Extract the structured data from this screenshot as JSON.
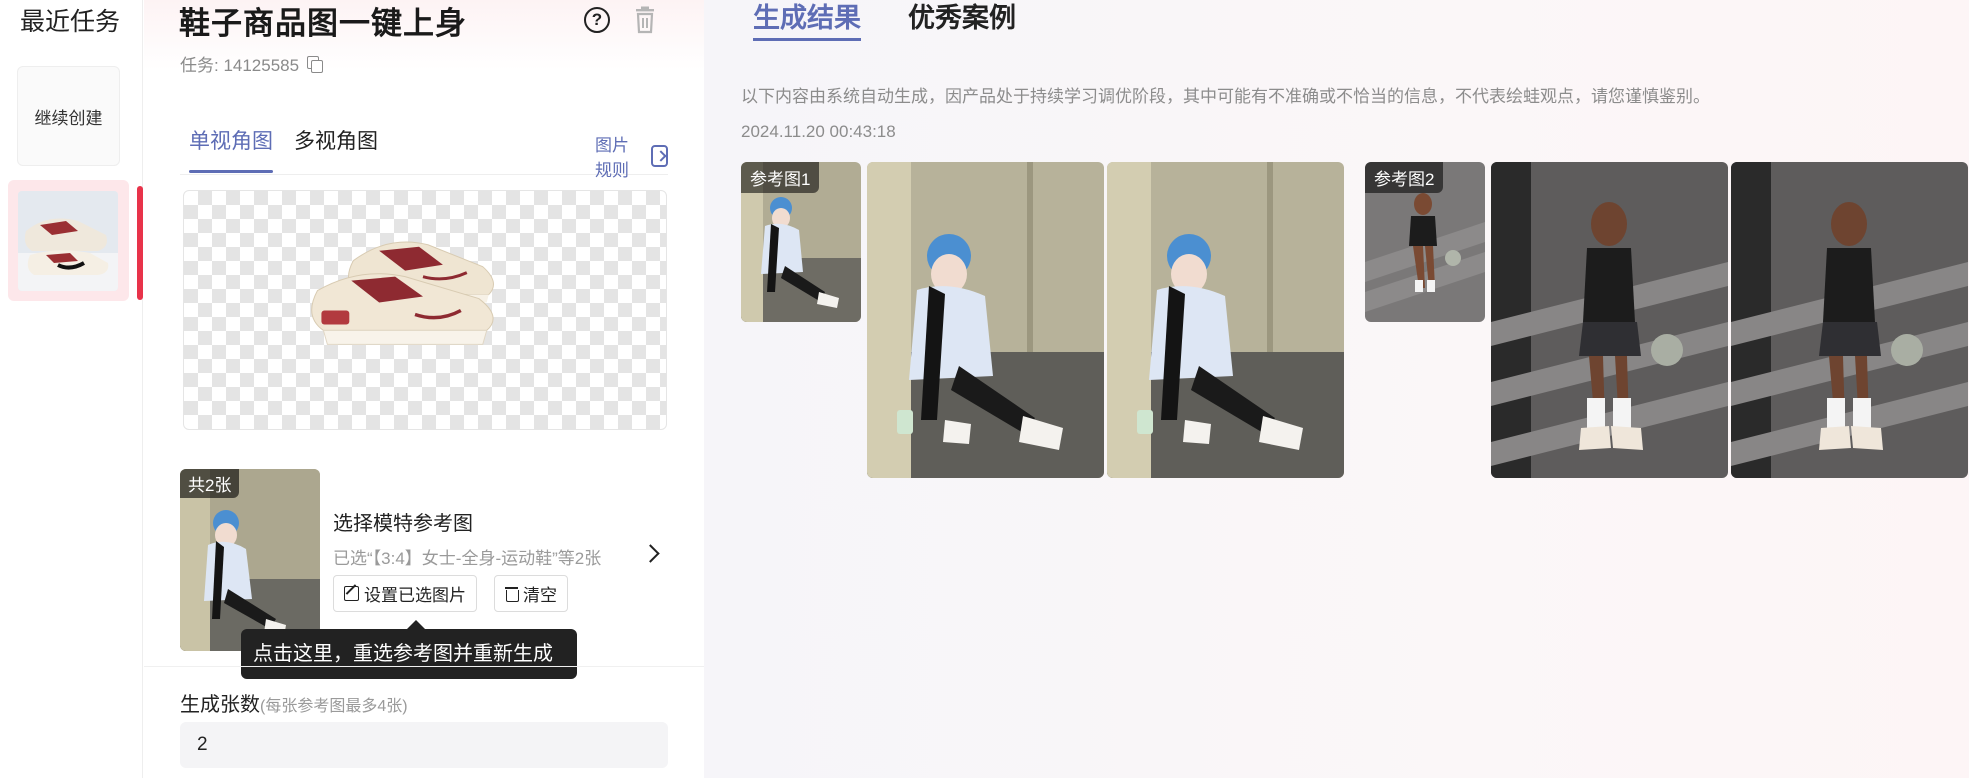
{
  "recent": {
    "title": "最近任务",
    "continue_label": "继续创建"
  },
  "editor": {
    "title": "鞋子商品图一键上身",
    "task_id": "任务: 14125585",
    "tabs": [
      "单视角图",
      "多视角图"
    ],
    "rules_link": "图片规则",
    "reference": {
      "count_badge": "共2张",
      "title": "选择模特参考图",
      "description": "已选“【3:4】女士-全身-运动鞋”等2张",
      "set_button": "设置已选图片",
      "clear_button": "清空"
    },
    "tooltip": "点击这里，重选参考图并重新生成",
    "count": {
      "label": "生成张数",
      "hint": "(每张参考图最多4张)",
      "value": "2"
    }
  },
  "results": {
    "tabs": [
      "生成结果",
      "优秀案例"
    ],
    "notice": "以下内容由系统自动生成，因产品处于持续学习调优阶段，其中可能有不准确或不恰当的信息，不代表绘蛙观点，请您谨慎鉴别。",
    "timestamp": "2024.11.20 00:43:18",
    "groups": [
      {
        "ref_label": "参考图1"
      },
      {
        "ref_label": "参考图2"
      }
    ]
  },
  "colors": {
    "accent": "#5e6db5",
    "active_marker": "#e8334a",
    "tooltip_bg": "#222222"
  },
  "icons": [
    "help-icon",
    "trash-icon",
    "copy-icon",
    "external-link-icon",
    "chevron-right-icon",
    "edit-icon"
  ]
}
